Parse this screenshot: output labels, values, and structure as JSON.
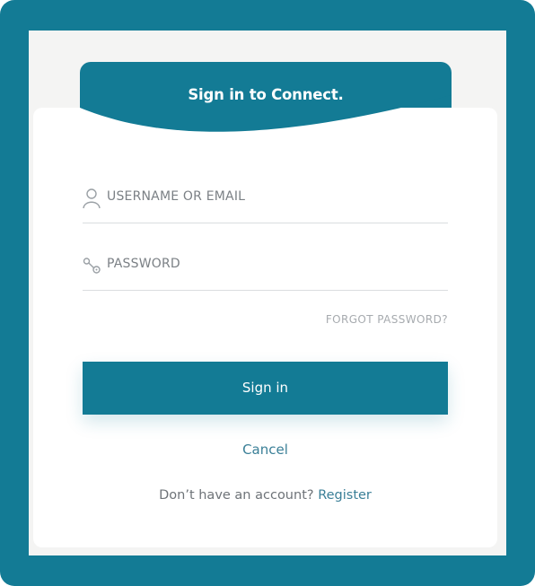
{
  "header": {
    "title": "Sign in to Connect."
  },
  "form": {
    "username_label": "USERNAME OR EMAIL",
    "password_label": "PASSWORD",
    "forgot_link": "FORGOT PASSWORD?",
    "signin_button": "Sign in",
    "cancel_link": "Cancel",
    "register_prompt": "Don’t have an account?",
    "register_link": "Register"
  },
  "icons": {
    "username": "user-icon",
    "password": "key-icon"
  },
  "colors": {
    "brand": "#137b95",
    "background": "#f4f4f3",
    "card": "#ffffff",
    "link": "#3a7f97",
    "muted_text": "#7b8085"
  }
}
